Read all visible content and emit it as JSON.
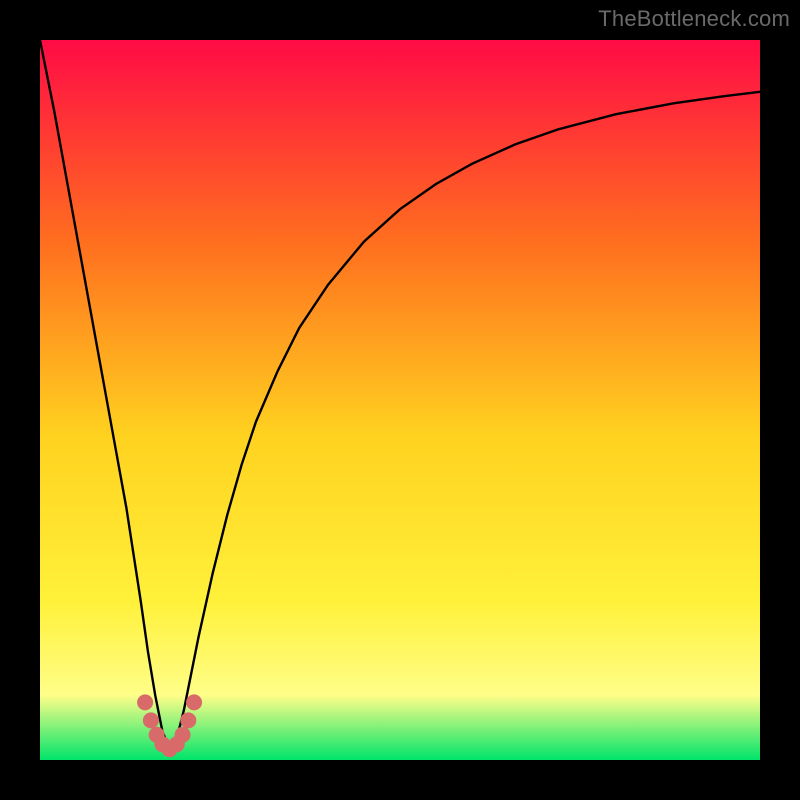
{
  "watermark": "TheBottleneck.com",
  "colors": {
    "frame": "#000000",
    "gradient_top": "#ff0b45",
    "gradient_mid_upper": "#ff6e1f",
    "gradient_mid": "#ffd21f",
    "gradient_mid_lower": "#fff13a",
    "gradient_low_yellow": "#fffe88",
    "gradient_bottom": "#00e46a",
    "curve": "#000000",
    "markers": "#d96a6a"
  },
  "chart_data": {
    "type": "line",
    "title": "",
    "xlabel": "",
    "ylabel": "",
    "xlim": [
      0,
      100
    ],
    "ylim": [
      0,
      100
    ],
    "minimum_x": 18,
    "series": [
      {
        "name": "bottleneck-curve",
        "x": [
          0,
          2,
          4,
          6,
          8,
          10,
          12,
          14,
          15,
          16,
          17,
          18,
          19,
          20,
          21,
          22,
          24,
          26,
          28,
          30,
          33,
          36,
          40,
          45,
          50,
          55,
          60,
          66,
          72,
          80,
          88,
          95,
          100
        ],
        "y": [
          100,
          90,
          79,
          68,
          57,
          46,
          35,
          22,
          15,
          9,
          4,
          1.5,
          3,
          7,
          12,
          17,
          26,
          34,
          41,
          47,
          54,
          60,
          66,
          72,
          76.5,
          80,
          82.8,
          85.5,
          87.6,
          89.7,
          91.2,
          92.2,
          92.8
        ]
      }
    ],
    "markers": {
      "name": "near-minimum-dots",
      "x": [
        14.6,
        15.4,
        16.2,
        17.0,
        18.0,
        19.0,
        19.8,
        20.6,
        21.4
      ],
      "y": [
        8.0,
        5.5,
        3.5,
        2.2,
        1.5,
        2.2,
        3.5,
        5.5,
        8.0
      ]
    }
  }
}
